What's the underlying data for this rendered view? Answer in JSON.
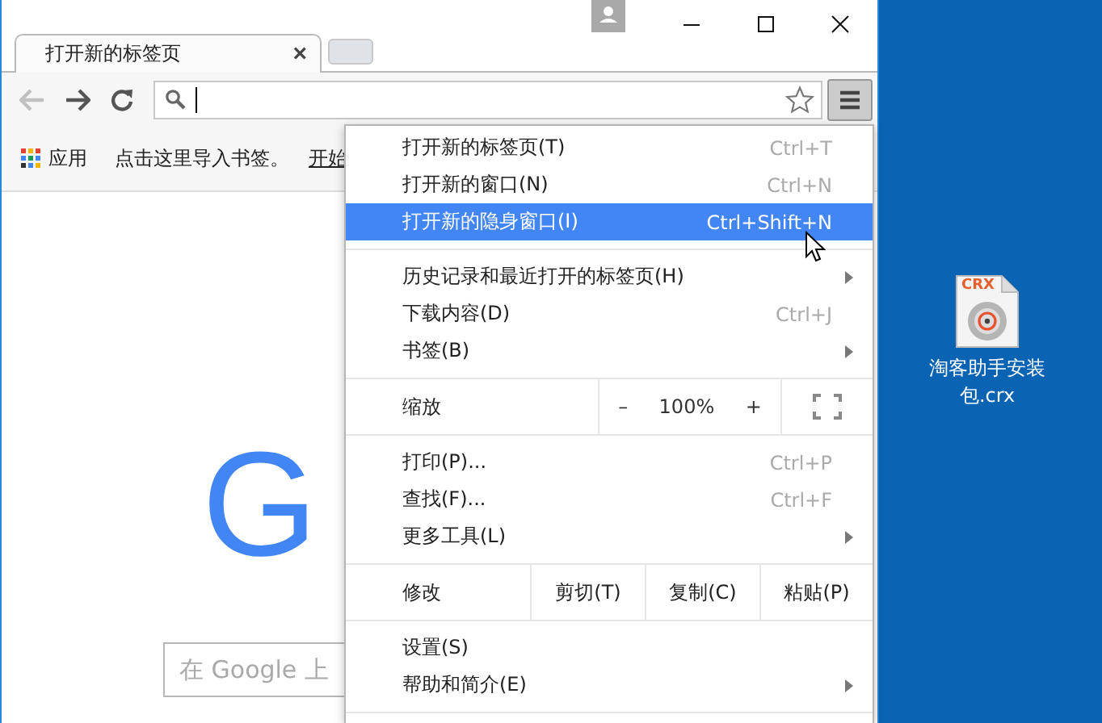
{
  "browser": {
    "tab": {
      "title": "打开新的标签页",
      "close": "×"
    },
    "bookmarks_bar": {
      "apps": "应用",
      "prompt": "点击这里导入书签。",
      "link": "开始"
    },
    "page": {
      "logo": "G",
      "search_placeholder": "在 Google 上"
    }
  },
  "menu": {
    "items": [
      {
        "kind": "item",
        "label": "打开新的标签页(T)",
        "shortcut": "Ctrl+T",
        "submenu": false,
        "selected": false
      },
      {
        "kind": "item",
        "label": "打开新的窗口(N)",
        "shortcut": "Ctrl+N",
        "submenu": false,
        "selected": false
      },
      {
        "kind": "item",
        "label": "打开新的隐身窗口(I)",
        "shortcut": "Ctrl+Shift+N",
        "submenu": false,
        "selected": true
      },
      {
        "kind": "separator"
      },
      {
        "kind": "item",
        "label": "历史记录和最近打开的标签页(H)",
        "submenu": true,
        "selected": false
      },
      {
        "kind": "item",
        "label": "下载内容(D)",
        "shortcut": "Ctrl+J",
        "submenu": false,
        "selected": false
      },
      {
        "kind": "item",
        "label": "书签(B)",
        "submenu": true,
        "selected": false
      },
      {
        "kind": "separator"
      },
      {
        "kind": "zoom",
        "label": "缩放",
        "minus": "–",
        "value": "100%",
        "plus": "+"
      },
      {
        "kind": "separator"
      },
      {
        "kind": "item",
        "label": "打印(P)...",
        "shortcut": "Ctrl+P",
        "submenu": false,
        "selected": false
      },
      {
        "kind": "item",
        "label": "查找(F)...",
        "shortcut": "Ctrl+F",
        "submenu": false,
        "selected": false
      },
      {
        "kind": "item",
        "label": "更多工具(L)",
        "submenu": true,
        "selected": false
      },
      {
        "kind": "separator"
      },
      {
        "kind": "edit",
        "label": "修改",
        "actions": [
          "剪切(T)",
          "复制(C)",
          "粘贴(P)"
        ]
      },
      {
        "kind": "separator"
      },
      {
        "kind": "item",
        "label": "设置(S)",
        "submenu": false,
        "selected": false
      },
      {
        "kind": "item",
        "label": "帮助和简介(E)",
        "submenu": true,
        "selected": false
      },
      {
        "kind": "separator"
      }
    ]
  },
  "desktop": {
    "icons": [
      {
        "badge": "CRX",
        "label": "淘客助手安装包.crx"
      }
    ]
  }
}
